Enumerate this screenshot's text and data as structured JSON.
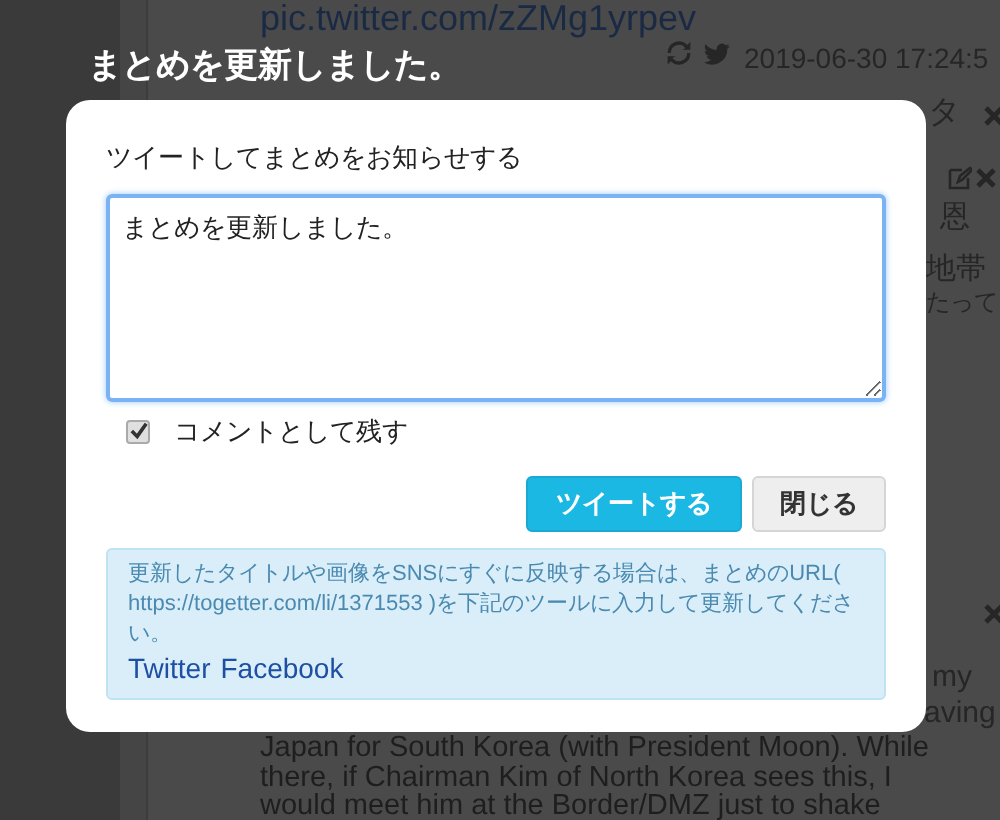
{
  "background": {
    "link": "pic.twitter.com/zZMg1yrpev",
    "timestamp": "2019-06-30 17:24:5",
    "fragments": [
      "タ",
      "恩",
      "地帯",
      "たって",
      "my",
      "aving"
    ],
    "lines": [
      "Japan for South Korea (with President Moon). While",
      "there, if Chairman Kim of North Korea sees this, I",
      "would meet him at the Border/DMZ just to shake"
    ]
  },
  "dialog": {
    "heading": "まとめを更新しました。",
    "label": "ツイートしてまとめをお知らせする",
    "message": "まとめを更新しました。",
    "keep_comment": {
      "label": "コメントとして残す",
      "checked": true
    },
    "buttons": [
      {
        "label": "ツイートする",
        "kind": "primary"
      },
      {
        "label": "閉じる",
        "kind": "default"
      }
    ],
    "notice": {
      "text": "更新したタイトルや画像をSNSにすぐに反映する場合は、まとめのURL( https://togetter.com/li/1371553 )を下記のツールに入力して更新してください。",
      "links": [
        "Twitter",
        "Facebook"
      ]
    }
  }
}
